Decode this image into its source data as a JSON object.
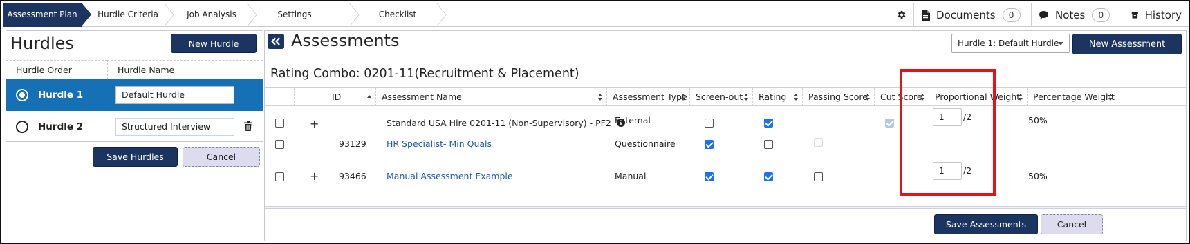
{
  "nav": {
    "steps": [
      "Assessment Plan",
      "Hurdle Criteria",
      "Job Analysis",
      "Settings",
      "Checklist"
    ],
    "settings_icon": "gear-icon",
    "documents": {
      "label": "Documents",
      "count": "0",
      "icon": "document-icon"
    },
    "notes": {
      "label": "Notes",
      "count": "0",
      "icon": "speech-bubble-icon"
    },
    "history": {
      "label": "History",
      "icon": "archive-box-icon"
    }
  },
  "hurdles": {
    "title": "Hurdles",
    "new_button": "New Hurdle",
    "col_order": "Hurdle Order",
    "col_name": "Hurdle Name",
    "rows": [
      {
        "label": "Hurdle 1",
        "name": "Default Hurdle",
        "selected": true
      },
      {
        "label": "Hurdle 2",
        "name": "Structured Interview",
        "selected": false
      }
    ],
    "save_button": "Save Hurdles",
    "cancel_button": "Cancel"
  },
  "assessments": {
    "title": "Assessments",
    "hurdle_select": "Hurdle 1: Default Hurdle",
    "new_button": "New Assessment",
    "combo": "Rating Combo: 0201-11(Recruitment & Placement)",
    "columns": [
      "ID",
      "Assessment Name",
      "Assessment Type",
      "Screen-out",
      "Rating",
      "Passing Score",
      "Cut Score",
      "Proportional Weight",
      "Percentage Weight"
    ],
    "rows": [
      {
        "id": "",
        "name": "Standard USA Hire 0201-11 (Non-Supervisory) - PF2",
        "is_link": false,
        "info_icon": "info-circle-icon",
        "type": "External",
        "expandable": true,
        "screenout": false,
        "rating": true,
        "passing": null,
        "cut": "disabled-checked",
        "weight": "1",
        "weight_total": "/2",
        "percent": "50%"
      },
      {
        "id": "93129",
        "name": "HR Specialist- Min Quals",
        "is_link": true,
        "type": "Questionnaire",
        "expandable": false,
        "screenout": true,
        "rating": false,
        "passing": "disabled",
        "cut": null,
        "weight": "",
        "weight_total": "",
        "percent": ""
      },
      {
        "id": "93466",
        "name": "Manual Assessment Example",
        "is_link": true,
        "type": "Manual",
        "expandable": true,
        "screenout": true,
        "rating": true,
        "passing": false,
        "cut": null,
        "weight": "1",
        "weight_total": "/2",
        "percent": "50%"
      }
    ],
    "save_button": "Save Assessments",
    "cancel_button": "Cancel",
    "highlight_color": "#e0141a"
  },
  "colors": {
    "primary": "#1b3560",
    "selected_row": "#1670b5",
    "link": "#1f5ba8",
    "checkbox": "#1a73e8"
  }
}
